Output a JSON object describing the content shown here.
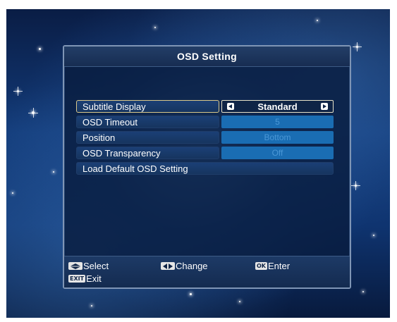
{
  "dialog": {
    "title": "OSD Setting"
  },
  "menu": {
    "items": [
      {
        "label": "Subtitle Display",
        "value": "Standard"
      },
      {
        "label": "OSD Timeout",
        "value": "5"
      },
      {
        "label": "Position",
        "value": "Bottom"
      },
      {
        "label": "OSD Transparency",
        "value": "Off"
      },
      {
        "label": "Load Default OSD Setting"
      }
    ]
  },
  "footer": {
    "select_label": "Select",
    "change_label": "Change",
    "enter_key": "OK",
    "enter_label": "Enter",
    "exit_key": "EXIT",
    "exit_label": "Exit"
  },
  "icons": {
    "select": "up-down-arrows-icon",
    "change": "left-right-arrows-icon",
    "left": "left-arrow-icon",
    "right": "right-arrow-icon"
  },
  "colors": {
    "selection_border": "#d9c88a",
    "value_fill": "#1a6db3",
    "value_text": "#4a97d6",
    "panel": "#0b1e42"
  }
}
